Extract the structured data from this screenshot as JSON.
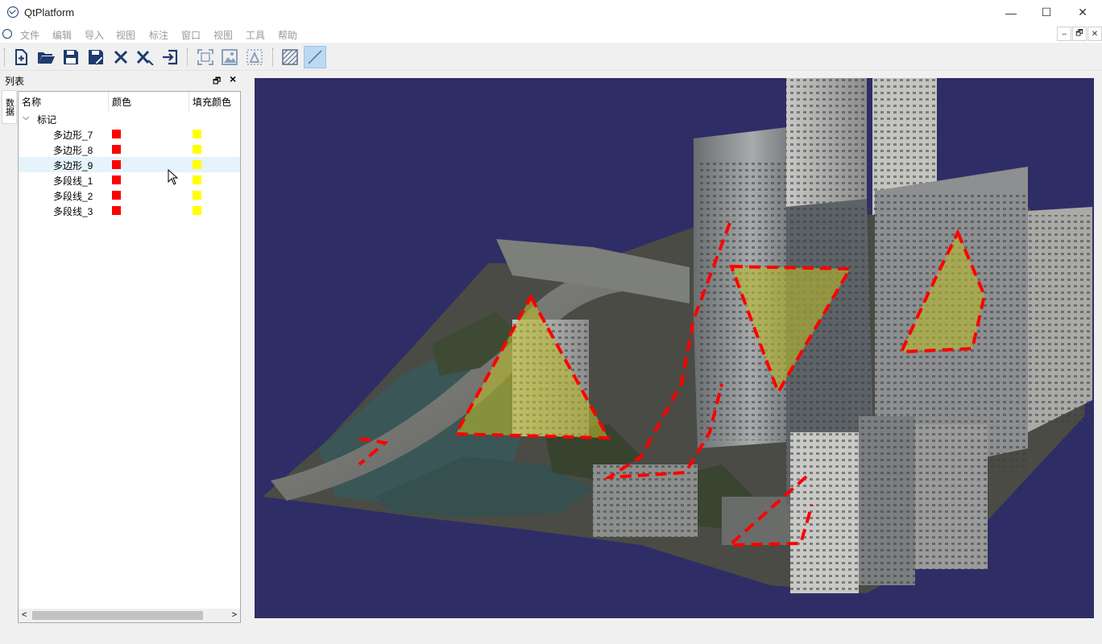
{
  "window": {
    "title": "QtPlatform",
    "minimize_glyph": "—",
    "maximize_glyph": "☐",
    "close_glyph": "✕"
  },
  "menubar": {
    "items": [
      "文件",
      "编辑",
      "导入",
      "视图",
      "标注",
      "窗口",
      "视图",
      "工具",
      "帮助"
    ]
  },
  "mdi": {
    "minimize": "–",
    "restore": "🗗",
    "close": "✕"
  },
  "toolbar": {
    "buttons": [
      "new-file",
      "open-folder",
      "save",
      "save-as",
      "close",
      "close-all",
      "exit",
      "zoom-extent",
      "zoom-image",
      "zoom-selection",
      "fill-pattern",
      "line-draw"
    ]
  },
  "dock": {
    "title": "列表",
    "side_tab": "数据"
  },
  "tree": {
    "columns": [
      "名称",
      "颜色",
      "填充颜色"
    ],
    "group": "标记",
    "items": [
      "多边形_7",
      "多边形_8",
      "多边形_9",
      "多段线_1",
      "多段线_2",
      "多段线_3"
    ],
    "selected_index": 2,
    "color": "#ff0000",
    "fill_color": "#ffff00"
  },
  "colors": {
    "accent": "#1e3a6e",
    "viewport_bg": "#2f2d66",
    "annotation_red": "#ff0000",
    "fill_yellow": "#b9b92d"
  }
}
